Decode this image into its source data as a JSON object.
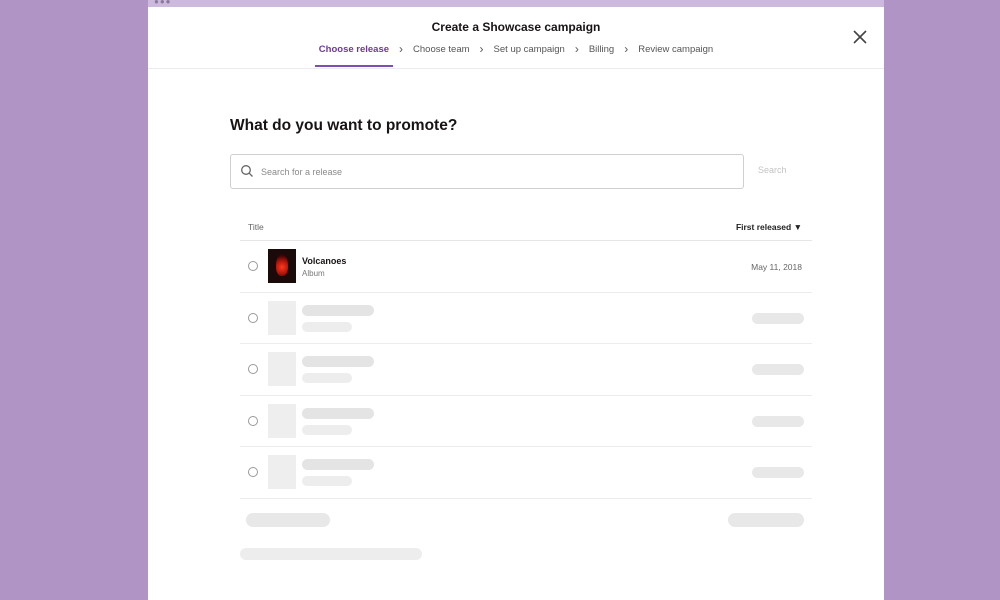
{
  "modal": {
    "title": "Create a Showcase campaign",
    "close_icon": "close-icon",
    "steps": [
      {
        "label": "Choose release",
        "active": true
      },
      {
        "label": "Choose team",
        "active": false
      },
      {
        "label": "Set up campaign",
        "active": false
      },
      {
        "label": "Billing",
        "active": false
      },
      {
        "label": "Review campaign",
        "active": false
      }
    ]
  },
  "main": {
    "heading": "What do you want to promote?",
    "search": {
      "placeholder": "Search for a release",
      "value": "",
      "button_label": "Search",
      "icon": "search-icon"
    },
    "table": {
      "columns": {
        "title": "Title",
        "date": "First released ▼"
      },
      "rows": [
        {
          "title": "Volcanoes",
          "subtitle": "Album",
          "date": "May 11, 2018",
          "selected": false
        }
      ],
      "placeholder_rows": 4
    }
  },
  "colors": {
    "background": "#b094c6",
    "accent": "#7c4fb0",
    "active_step": "#6b3a9a"
  }
}
